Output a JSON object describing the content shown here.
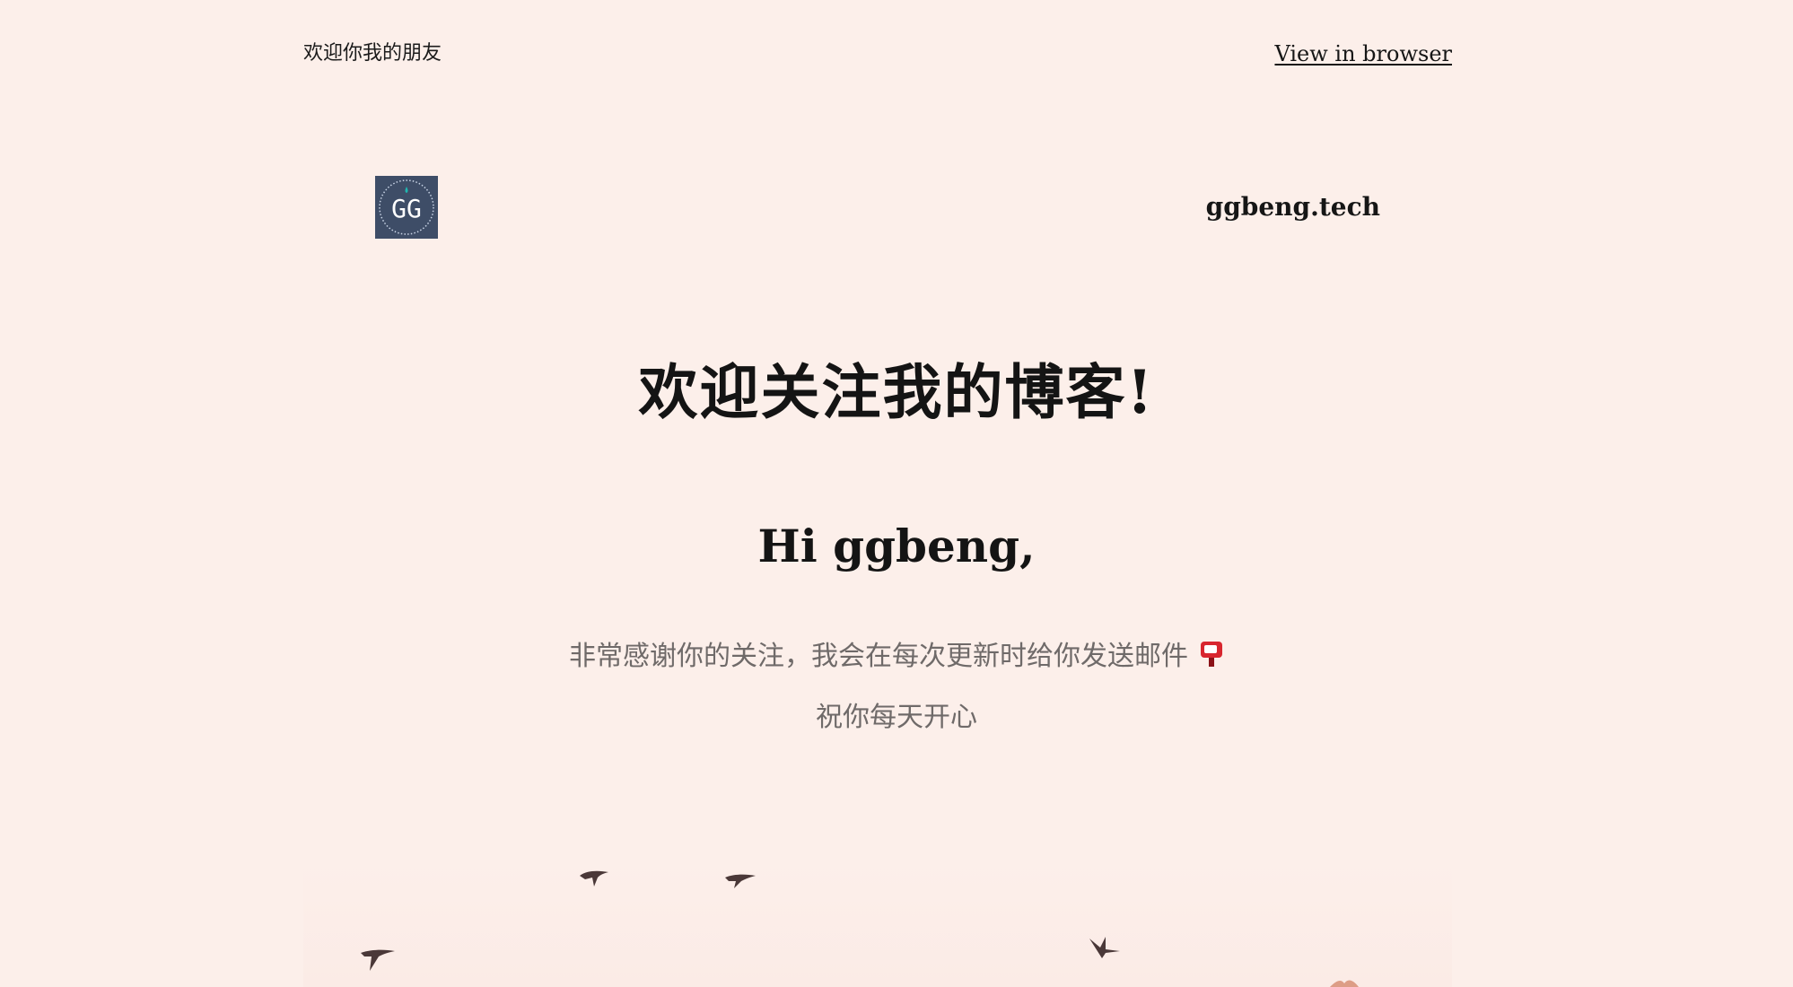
{
  "preheader": {
    "text": "欢迎你我的朋友",
    "view_link": "View in browser"
  },
  "header": {
    "logo_icon": "gg-logo-icon",
    "logo_text": "GG",
    "logo_color": "#3e4d67",
    "site_name": "ggbeng.tech"
  },
  "content": {
    "headline": "欢迎关注我的博客!",
    "greeting": "Hi ggbeng,",
    "line1": "非常感谢你的关注，我会在每次更新时给你发送邮件",
    "line1_icon": "mailbox-icon",
    "line2": "祝你每天开心"
  },
  "hero": {
    "image": "birds-flying-image"
  },
  "colors": {
    "background": "#fcefea",
    "text": "#161616",
    "muted_text": "#6f6a69",
    "accent": "#d8262f"
  }
}
